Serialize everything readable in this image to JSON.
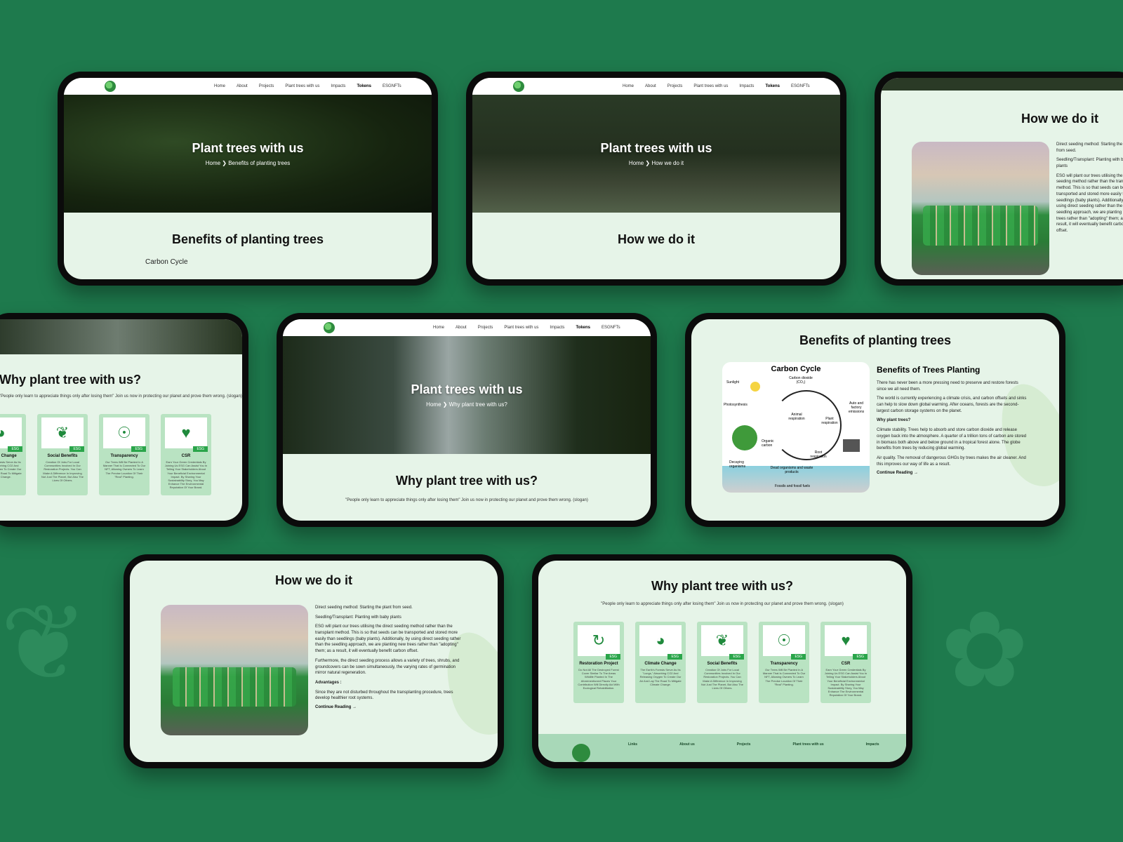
{
  "nav": {
    "items": [
      "Home",
      "About",
      "Projects",
      "Plant trees with us",
      "Impacts",
      "Tokens",
      "ESGNFTs"
    ],
    "active": "Tokens"
  },
  "hero": {
    "title": "Plant trees with us",
    "crumb_benefits": "Home ❯ Benefits of planting trees",
    "crumb_how": "Home ❯ How we do it",
    "crumb_why": "Home ❯ Why plant tree with us?"
  },
  "sections": {
    "benefits_title": "Benefits of planting trees",
    "how_title": "How we do it",
    "why_title": "Why plant tree with us?",
    "carbon_cycle_peek": "Carbon Cycle"
  },
  "slogan": "\"People only learn to appreciate things only after losing them\" Join us now in protecting our planet and prove them wrong. (slogan)",
  "benefits": {
    "subtitle": "Benefits of Trees Planting",
    "p1": "There has never been a more pressing need to preserve and restore forests since we all need them.",
    "p2": "The world is currently experiencing a climate crisis, and carbon offsets and sinks can help to slow down global warming. After oceans, forests are the second-largest carbon storage systems on the planet.",
    "why": "Why plant trees?",
    "p3": "Climate stability. Trees help to absorb and store carbon dioxide and release oxygen back into the atmosphere. A quarter of a trillion tons of carbon are stored in biomass both above and below ground in a tropical forest alone. The globe benefits from trees by reducing global warming.",
    "p4": "Air quality. The removal of dangerous GHGs by trees makes the air cleaner. And this improves our way of life as a result.",
    "continue": "Continue Reading →",
    "diagram_title": "Carbon Cycle",
    "diagram_labels": [
      "Sunlight",
      "Carbon dioxide (CO₂)",
      "Photosynthesis",
      "Animal respiration",
      "Plant respiration",
      "Auto and factory emissions",
      "Organic carbon",
      "Root respiration",
      "Decaying organisms",
      "Dead organisms and waste products",
      "Fossils and fossil fuels"
    ]
  },
  "how": {
    "p1": "Direct seeding method: Starting the plant from seed.",
    "p2": "Seedling/Transplant: Planting with baby plants",
    "p3": "ESG will plant our trees utilising the direct seeding method rather than the transplant method. This is so that seeds can be transported and stored more easily than seedlings (baby plants). Additionally, by using direct seeding rather than the seedling approach, we are planting new trees rather than \"adopting\" them; as a result, it will eventually benefit carbon offset.",
    "p4": "Furthermore, the direct seeding process allows a variety of trees, shrubs, and groundcovers can be sown simultaneously, the varying rates of germination mirror natural regeneration.",
    "advantages": "Advantages :",
    "p5": "Since they are not disturbed throughout the transplanting procedure, trees develop healthier root systems.",
    "continue": "Continue Reading →"
  },
  "cards": [
    {
      "title": "Restoration Project",
      "tag": "ESG",
      "icon": "refresh-icon",
      "glyph": "↻",
      "desc": "Do Not All The Destroyed Forest Cover Similar To The Areas Wildlife Planted In The Aforementioned Places Your Contribution Will Directly Aid With Ecological Rehabilitation."
    },
    {
      "title": "Climate Change",
      "tag": "ESG",
      "icon": "globe-icon",
      "glyph": "◕",
      "desc": "The Earth's Forests Serve As Its \"Lungs,\" Absorbing CO2 And Releasing Oxygen To Create Our Air And Lay The Road To Mitigate Climate Change."
    },
    {
      "title": "Social Benefits",
      "tag": "ESG",
      "icon": "hands-icon",
      "glyph": "❦",
      "desc": "Creation Of Jobs For Local Communities Involved In Our Restoration Projects. You Can Make A Difference In Improving Not Just The Planet, But Also The Lives Of Others."
    },
    {
      "title": "Transparency",
      "tag": "ESG",
      "icon": "magnifier-icon",
      "glyph": "☉",
      "desc": "Our Trees Will Be Planted In A Manner That Is Connected To Our NFT, Allowing Owners To Learn The Precise Location Of Their \"Real\" Planting."
    },
    {
      "title": "CSR",
      "tag": "ESG",
      "icon": "heart-icon",
      "glyph": "♥",
      "desc": "Earn Your Green Credentials By Joining Us ESG Can Assist You In Telling Your Stakeholders About Your Beneficial Environmental Impact. By Sharing Your Sustainability Story, You May Enhance The Environmental Reputation Of Your Brand."
    }
  ],
  "footer": [
    "Links",
    "About us",
    "Projects",
    "Plant trees with us",
    "Impacts"
  ]
}
